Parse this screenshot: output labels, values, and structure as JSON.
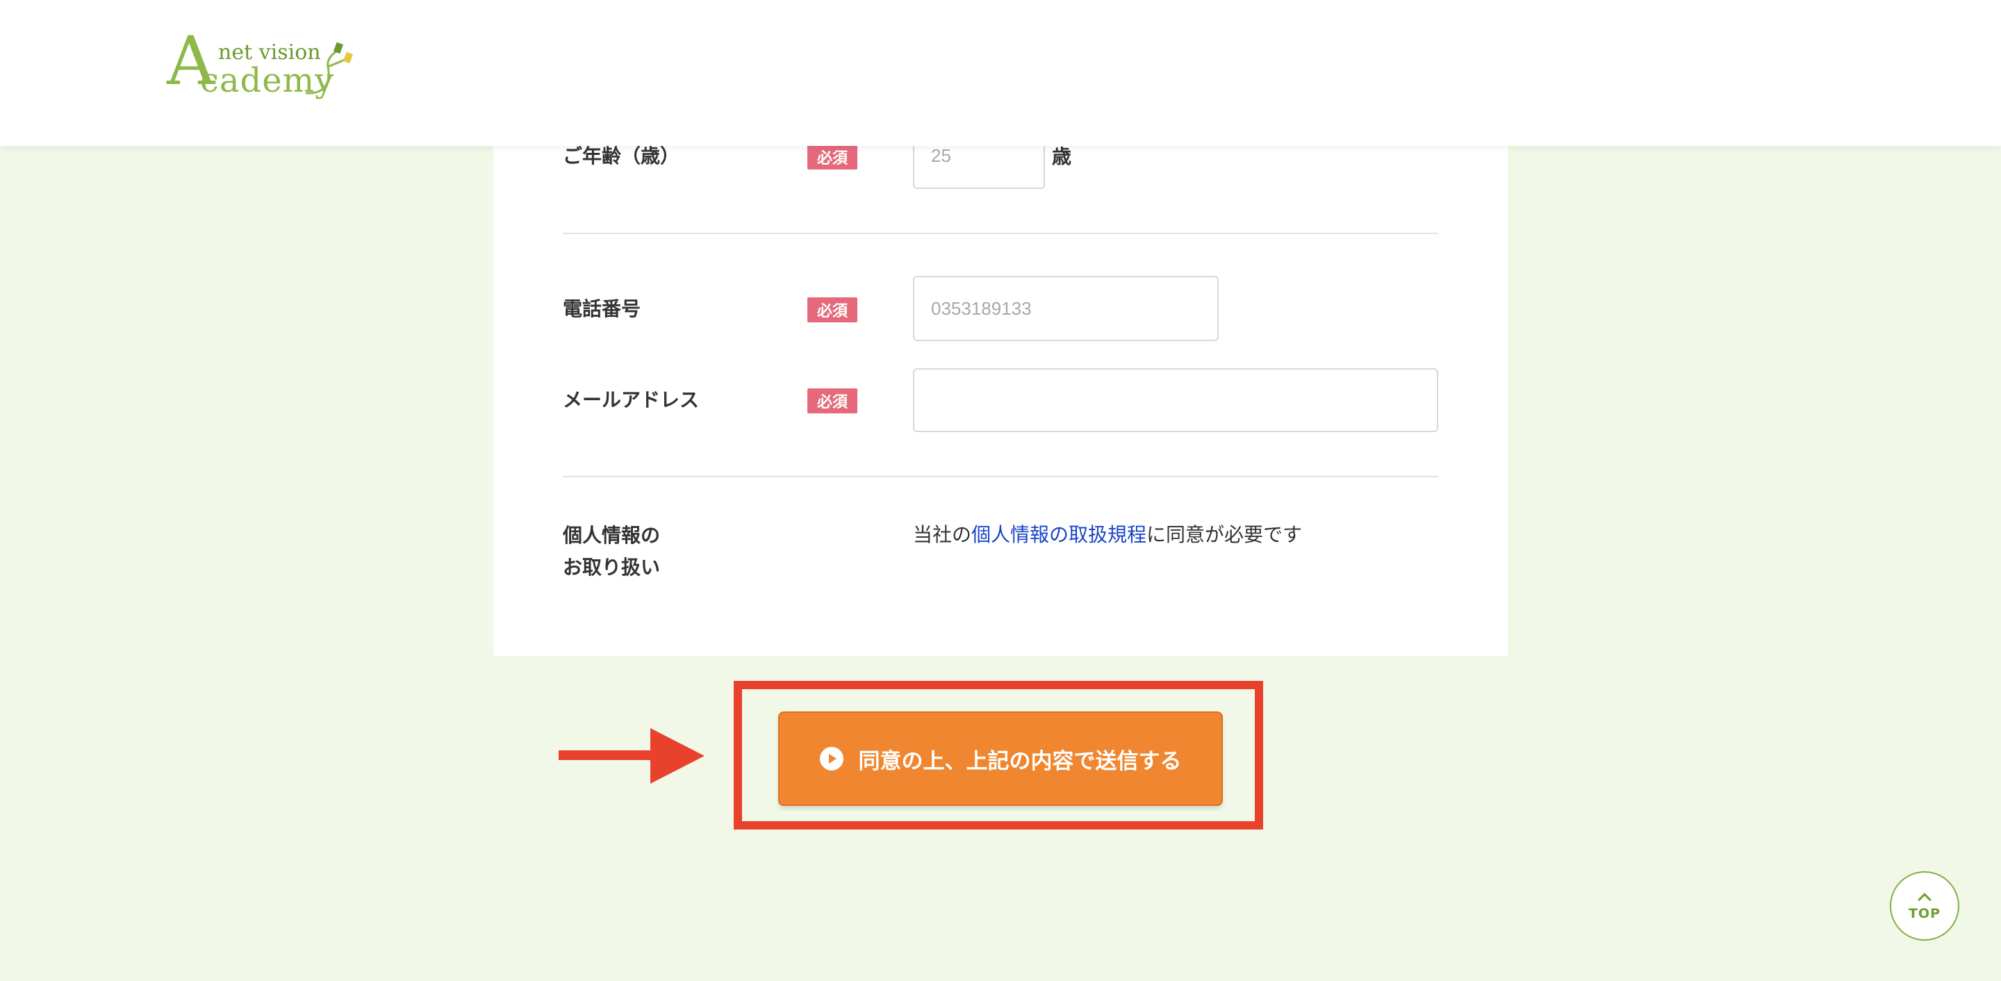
{
  "header": {
    "logo_big_letter": "A",
    "logo_top_text": "net vision",
    "logo_bottom_text": "cademy"
  },
  "form": {
    "age": {
      "label": "ご年齢（歳）",
      "required": "必須",
      "placeholder": "25",
      "unit": "歳"
    },
    "phone": {
      "label": "電話番号",
      "required": "必須",
      "placeholder": "0353189133"
    },
    "email": {
      "label": "メールアドレス",
      "required": "必須",
      "placeholder": ""
    },
    "privacy": {
      "label_line1": "個人情報の",
      "label_line2": "お取り扱い",
      "text_before": "当社の",
      "link_text": "個人情報の取扱規程",
      "text_after": "に同意が必要です"
    }
  },
  "submit": {
    "label": "同意の上、上記の内容で送信する"
  },
  "top_button": {
    "label": "TOP"
  },
  "colors": {
    "background": "#f2f8e8",
    "required_badge": "#e5697a",
    "submit": "#f0862f",
    "highlight": "#e8412c",
    "link": "#1a44c8",
    "top_button": "#7fb23e"
  },
  "icons": {
    "submit": "play-circle-icon",
    "annotation": "red-arrow-icon",
    "top": "chevron-up-icon"
  }
}
